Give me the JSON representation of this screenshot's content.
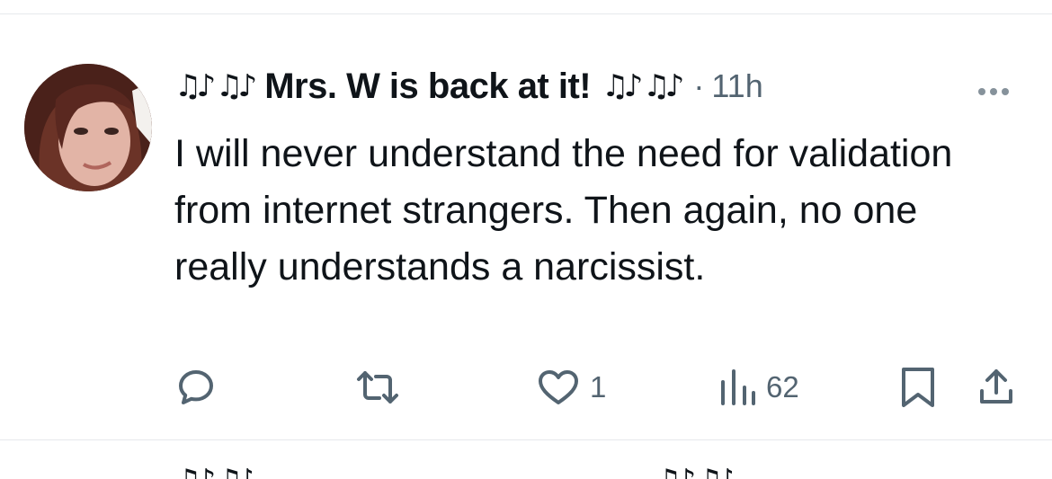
{
  "post": {
    "name_prefix": "♫♪ ♫♪",
    "display_name": "Mrs. W is back at it!",
    "name_suffix": "♫♪ ♫♪",
    "separator": "·",
    "timestamp": "11h",
    "text": "I will never understand the need for validation from internet strangers. Then again, no one really understands a narcissist."
  },
  "actions": {
    "reply_count": "",
    "repost_count": "",
    "like_count": "1",
    "views_count": "62"
  },
  "icons": {
    "reply": "reply-icon",
    "repost": "repost-icon",
    "like": "heart-icon",
    "views": "views-icon",
    "bookmark": "bookmark-icon",
    "share": "share-icon",
    "more": "more-icon"
  },
  "colors": {
    "text": "#0f1419",
    "secondary": "#536471",
    "divider": "#e6e9ec"
  }
}
